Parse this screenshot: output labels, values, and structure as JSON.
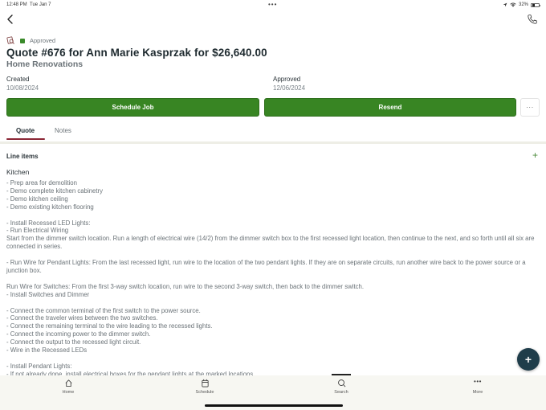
{
  "status_bar": {
    "time": "12:48 PM",
    "date": "Tue Jan 7",
    "dots": "•••",
    "battery_percent": "32%"
  },
  "header": {
    "back_icon": "chevron-left-icon",
    "phone_icon": "phone-icon"
  },
  "quote": {
    "status": "Approved",
    "status_color": "#3a8a2a",
    "title": "Quote #676 for Ann Marie Kasprzak for $26,640.00",
    "subtitle": "Home Renovations",
    "created_label": "Created",
    "created_value": "10/08/2024",
    "approved_label": "Approved",
    "approved_value": "12/06/2024"
  },
  "actions": {
    "schedule_job": "Schedule Job",
    "resend": "Resend",
    "more": "···",
    "accent_color": "#388523"
  },
  "tabs": [
    {
      "label": "Quote",
      "active": true
    },
    {
      "label": "Notes",
      "active": false
    }
  ],
  "line_items": {
    "header": "Line items",
    "add": "+",
    "group_title": "Kitchen",
    "description": "- Prep area for demolition\n- Demo complete kitchen cabinetry\n- Demo kitchen ceiling\n- Demo existing kitchen flooring\n\n- Install Recessed LED Lights:\n- Run Electrical Wiring\nStart from the dimmer switch location. Run a length of electrical wire (14/2) from the dimmer switch box to the first recessed light location, then continue to the next, and so forth until all six are connected in series.\n\n- Run Wire for Pendant Lights: From the last recessed light, run wire to the location of the two pendant lights. If they are on separate circuits, run another wire back to the power source or a junction box.\n\nRun Wire for Switches: From the first 3-way switch location, run wire to the second 3-way switch, then back to the dimmer switch.\n- Install Switches and Dimmer\n\n- Connect the common terminal of the first switch to the power source.\n- Connect the traveler wires between the two switches.\n- Connect the remaining terminal to the wire leading to the recessed lights.\n- Connect the incoming power to the dimmer switch.\n- Connect the output to the recessed light circuit.\n- Wire in the Recessed LEDs\n\n- Install Pendant Lights:\n- If not already done, install electrical boxes for the pendant lights at the marked locations."
  },
  "fab": {
    "label": "+",
    "color": "#1f3d4a"
  },
  "bottom_nav": [
    {
      "label": "Home",
      "icon": "home-icon"
    },
    {
      "label": "Schedule",
      "icon": "calendar-icon"
    },
    {
      "label": "Search",
      "icon": "search-icon"
    },
    {
      "label": "More",
      "icon": "more-icon"
    }
  ]
}
